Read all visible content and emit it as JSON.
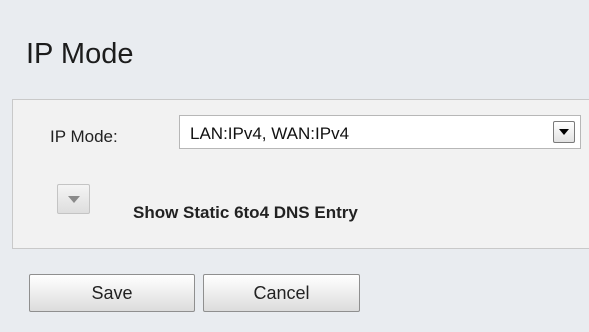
{
  "page": {
    "title": "IP Mode"
  },
  "settings": {
    "ip_mode_label": "IP Mode:",
    "ip_mode_value": "LAN:IPv4, WAN:IPv4",
    "expand_label": "Show Static 6to4 DNS Entry"
  },
  "actions": {
    "save_label": "Save",
    "cancel_label": "Cancel"
  },
  "icons": {
    "select_arrow": "triangle-down-icon",
    "expand_toggle": "triangle-down-icon"
  }
}
